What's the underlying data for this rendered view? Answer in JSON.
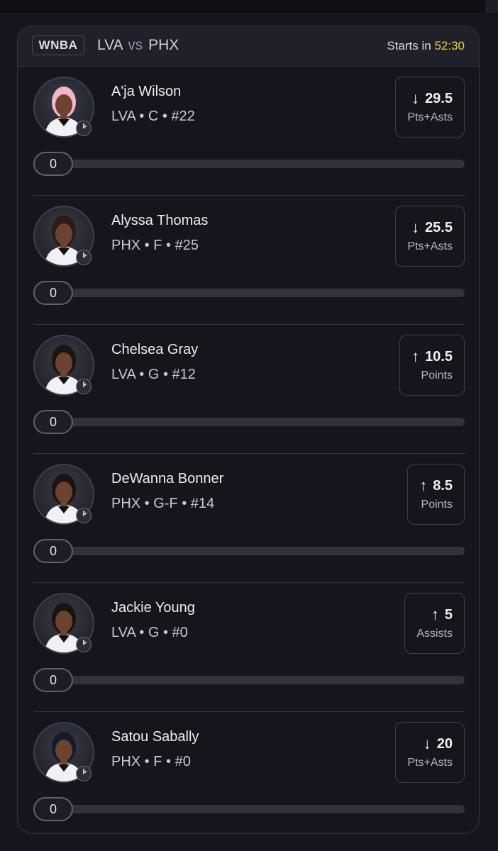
{
  "header": {
    "league": "WNBA",
    "team_home": "LVA",
    "vs": "vs",
    "team_away": "PHX",
    "starts_label": "Starts in",
    "starts_time": "52:30"
  },
  "colors": {
    "accent_time": "#f1d33c",
    "background": "#15161d"
  },
  "players": [
    {
      "name": "A'ja Wilson",
      "meta": "LVA • C • #22",
      "direction": "down",
      "arrow": "↓",
      "line": "29.5",
      "stat": "Pts+Asts",
      "progress": "0",
      "hair": "#f2b6c8"
    },
    {
      "name": "Alyssa Thomas",
      "meta": "PHX • F • #25",
      "direction": "down",
      "arrow": "↓",
      "line": "25.5",
      "stat": "Pts+Asts",
      "progress": "0",
      "hair": "#2a1c16"
    },
    {
      "name": "Chelsea Gray",
      "meta": "LVA • G • #12",
      "direction": "up",
      "arrow": "↑",
      "line": "10.5",
      "stat": "Points",
      "progress": "0",
      "hair": "#1c1410"
    },
    {
      "name": "DeWanna Bonner",
      "meta": "PHX • G-F • #14",
      "direction": "up",
      "arrow": "↑",
      "line": "8.5",
      "stat": "Points",
      "progress": "0",
      "hair": "#1c1410"
    },
    {
      "name": "Jackie Young",
      "meta": "LVA • G • #0",
      "direction": "up",
      "arrow": "↑",
      "line": "5",
      "stat": "Assists",
      "progress": "0",
      "hair": "#1c1410"
    },
    {
      "name": "Satou Sabally",
      "meta": "PHX • F • #0",
      "direction": "down",
      "arrow": "↓",
      "line": "20",
      "stat": "Pts+Asts",
      "progress": "0",
      "hair": "#141a2e"
    }
  ]
}
